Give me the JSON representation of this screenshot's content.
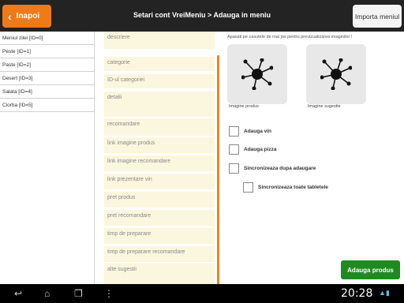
{
  "actionbar": {
    "back_label": "Inapoi",
    "title": "Setari cont VreiMeniu > Adauga in meniu",
    "import_label": "Importa meniul"
  },
  "categories": [
    "Meniul zilei [ID=0]",
    "Peste [ID=1]",
    "Paste [ID=2]",
    "Desert [ID=3]",
    "Salata [ID=4]",
    "Ciorba [ID=5]"
  ],
  "form": {
    "fields": [
      "descriere",
      "categorie",
      "ID-ul categoriei",
      "detalii",
      "recomandare",
      "link imagine produs",
      "link imagine recomandare",
      "link prezentare vin",
      "pret produs",
      "pret recomandare",
      "timp de preparare",
      "timp de preparare recomandare",
      "alte sugestii"
    ]
  },
  "right": {
    "hint": "Apasati pe casutele de mai jos pentru previzualizarea imaginilor !",
    "image_product_label": "Imagine produs",
    "image_suggestion_label": "Imagine sugestie",
    "checkboxes": [
      "Adauga vin",
      "Adauga pizza",
      "Sincronizeaza dupa adaugare",
      "Sincronizeaza toate tabletele"
    ],
    "add_label": "Adauga produs"
  },
  "statusbar": {
    "time": "20:28"
  },
  "colors": {
    "accent": "#ef7a1a",
    "add_button": "#1f8a1f",
    "field_bg": "#fbf6de"
  }
}
